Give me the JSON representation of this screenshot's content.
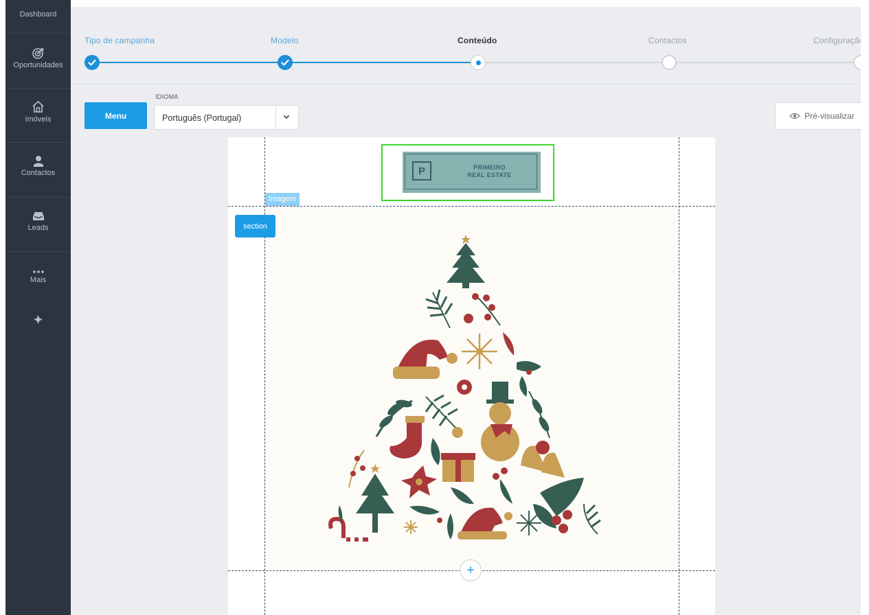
{
  "sidebar": {
    "items": [
      {
        "label": "Dashboard",
        "icon": "dashboard"
      },
      {
        "label": "Oportunidades",
        "icon": "target-icon"
      },
      {
        "label": "Imóveis",
        "icon": "house-icon"
      },
      {
        "label": "Contactos",
        "icon": "person-icon"
      },
      {
        "label": "Leads",
        "icon": "inbox-icon"
      },
      {
        "label": "Mais",
        "icon": "more-dots-icon"
      }
    ],
    "settings_icon": "gear-icon"
  },
  "stepper": {
    "steps": [
      {
        "label": "Tipo de campanha",
        "state": "done"
      },
      {
        "label": "Modelo",
        "state": "done"
      },
      {
        "label": "Conteúdo",
        "state": "current"
      },
      {
        "label": "Contactos",
        "state": "todo"
      },
      {
        "label": "Configuração",
        "state": "todo"
      }
    ]
  },
  "toolbar": {
    "menu_label": "Menu",
    "language_label": "IDIOMA",
    "language_value": "Português (Portugal)",
    "preview_label": "Pré-visualizar"
  },
  "editor": {
    "logo_line1": "PRIMEIRO",
    "logo_line2": "REAL ESTATE",
    "logo_letter": "P",
    "image_tag": "Imagem",
    "section_tag": "section",
    "add_symbol": "+"
  },
  "colors": {
    "accent": "#1d8fd8",
    "sidebar_bg": "#2c3440",
    "selection_outline": "#3dd62d"
  }
}
